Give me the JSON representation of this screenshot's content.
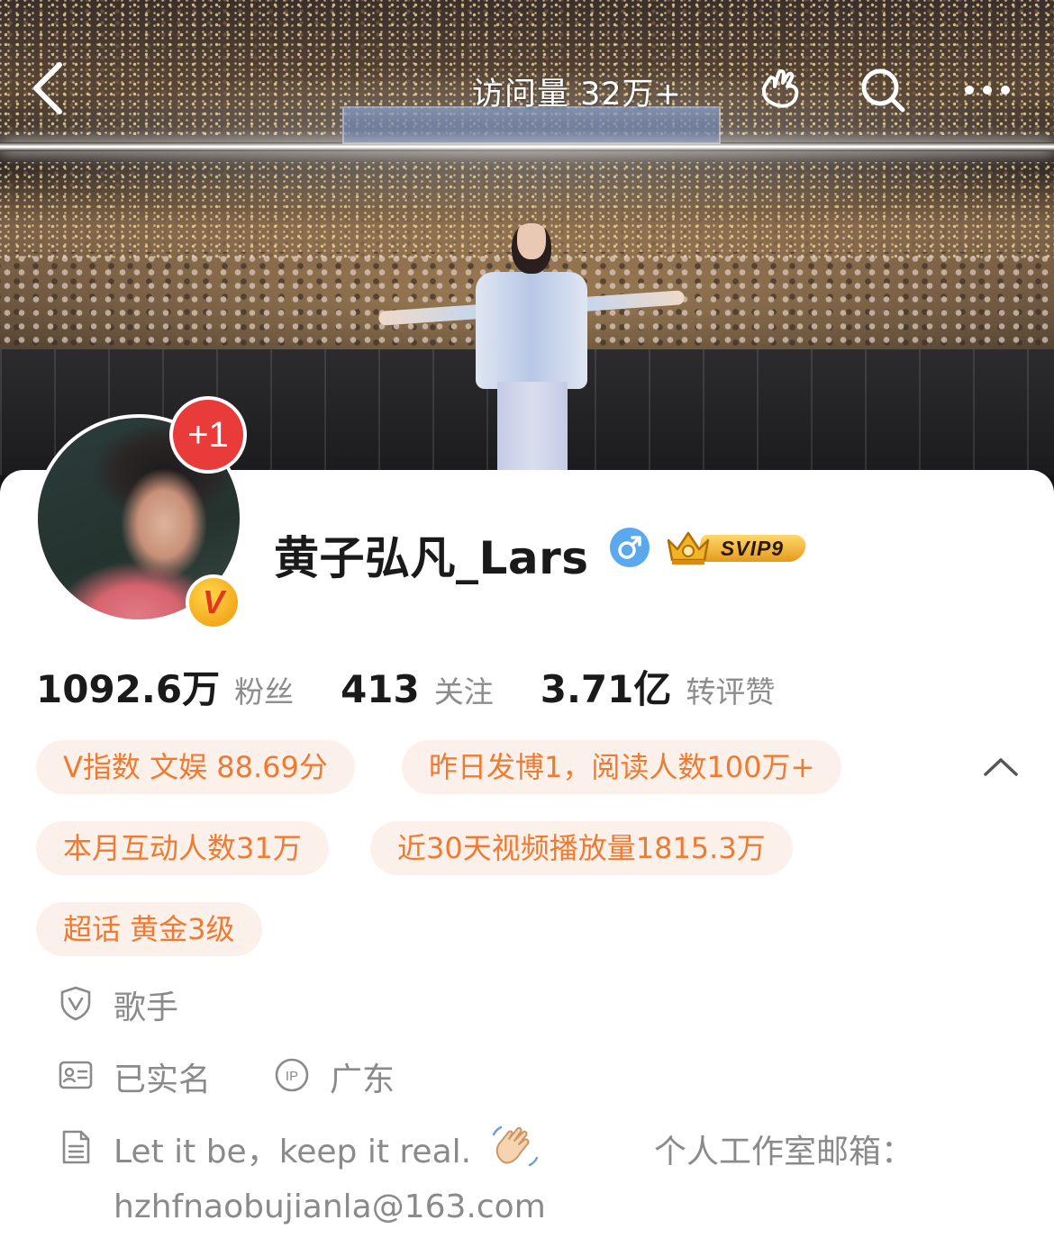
{
  "header": {
    "visit_count": "访问量 32万+",
    "icons": [
      "back-icon",
      "like-hand-icon",
      "search-icon",
      "more-icon"
    ]
  },
  "profile": {
    "avatar_badge": "+1",
    "verified_badge": "V",
    "name": "黄子弘凡_Lars",
    "gender": "male",
    "membership": "SVIP9"
  },
  "stats": [
    {
      "value": "1092.6万",
      "label": "粉丝"
    },
    {
      "value": "413",
      "label": "关注"
    },
    {
      "value": "3.71亿",
      "label": "转评赞"
    }
  ],
  "tags": [
    "V指数 文娱 88.69分",
    "昨日发博1，阅读人数100万+",
    "本月互动人数31万",
    "近30天视频播放量1815.3万",
    "超话 黄金3级"
  ],
  "info": {
    "occupation": "歌手",
    "real_name": "已实名",
    "ip_label": "IP",
    "ip_location": "广东",
    "bio": "Let it be，keep it real.",
    "bio_emoji": "waving-hand",
    "bio_extra": "个人工作室邮箱：",
    "email": "hzhfnaobujianla@163.com"
  },
  "colors": {
    "tag_text": "#f07a30",
    "tag_bg": "#fcf1ea",
    "badge_red": "#ea3b3b",
    "gender_blue": "#5aa9ef",
    "muted_text": "#8a8a8a"
  }
}
